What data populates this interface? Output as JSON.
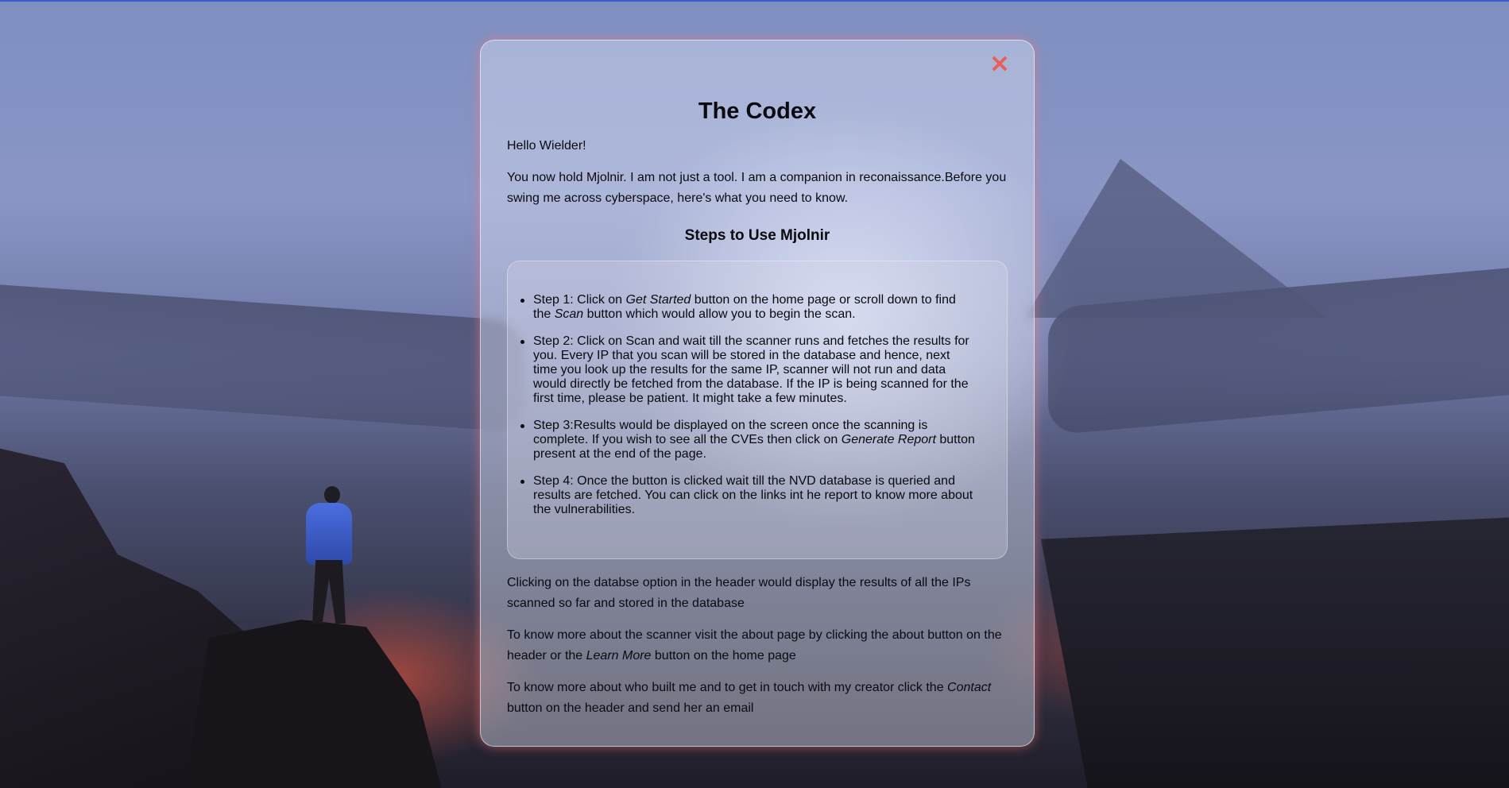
{
  "modal": {
    "close_icon": "close-icon",
    "close_glyph": "✕",
    "title": "The Codex",
    "greeting": "Hello Wielder!",
    "intro": "You now hold Mjolnir. I am not just a tool. I am a companion in reconaissance.Before you swing me across cyberspace, here's what you need to know.",
    "steps_heading": "Steps to Use Mjolnir",
    "steps": [
      {
        "a": "Step 1: Click on ",
        "em1": "Get Started",
        "b": " button on the home page or scroll down to find the ",
        "em2": "Scan",
        "c": " button which would allow you to begin the scan."
      },
      {
        "text": "Step 2: Click on Scan and wait till the scanner runs and fetches the results for you. Every IP that you scan will be stored in the database and hence, next time you look up the results for the same IP, scanner will not run and data would directly be fetched from the database. If the IP is being scanned for the first time, please be patient. It might take a few minutes."
      },
      {
        "a": "Step 3:Results would be displayed on the screen once the scanning is complete. If you wish to see all the CVEs then click on ",
        "em1": "Generate Report",
        "b": " button present at the end of the page."
      },
      {
        "text": "Step 4: Once the button is clicked wait till the NVD database is queried and results are fetched. You can click on the links int he report to know more about the vulnerabilities."
      }
    ],
    "database_note": "Clicking on the databse option in the header would display the results of all the IPs scanned so far and stored in the database",
    "about_note": {
      "a": "To know more about the scanner visit the about page by clicking the about button on the header or the ",
      "em": "Learn More",
      "b": " button on the home page"
    },
    "contact_note": {
      "a": "To know more about who built me and to get in touch with my creator click the ",
      "em": "Contact",
      "b": " button on the header and send her an email"
    }
  },
  "colors": {
    "close": "#e8605a",
    "text": "#0a0a0f",
    "top_border": "#3b5bd0"
  }
}
